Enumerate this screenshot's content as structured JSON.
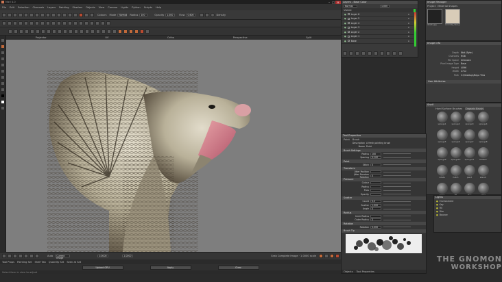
{
  "window": {
    "title": "Mari 4.0"
  },
  "menu": [
    "File",
    "Edit",
    "Selection",
    "Channels",
    "Layers",
    "Painting",
    "Shaders",
    "Objects",
    "View",
    "Camera",
    "Lights",
    "Python",
    "Scripts",
    "Help"
  ],
  "toolbar": {
    "colours_label": "Colours",
    "radius_label": "Radius",
    "radius_value": "100",
    "opacity_label": "Opacity",
    "opacity_value": "1.000",
    "flow_label": "Flow",
    "flow_value": "0.600",
    "density_label": "Density",
    "mode_label": "Mode",
    "mode_value": "Normal"
  },
  "viewport_tabs": [
    "Projector",
    "UV",
    "Ortho",
    "Perspective",
    "Split"
  ],
  "layers": {
    "title": "Layers - Base Color",
    "blend": "Normal",
    "opacity": "1.000",
    "header": "Visible",
    "items": [
      "Layer 6",
      "Layer 5",
      "Layer 4",
      "Layer 3",
      "Layer 2",
      "Layer 1",
      "Base"
    ]
  },
  "image_manager": {
    "title": "Image Manager",
    "tabs": [
      "Project",
      "Material Shapes"
    ],
    "thumbs": [
      "albedo.jpg",
      "concrete_clean_a_Diffuse_4k.jpg"
    ]
  },
  "image_info": {
    "title": "Image Info",
    "rows": [
      {
        "k": "Depth",
        "v": "8bit (Byte)"
      },
      {
        "k": "Channels",
        "v": "RGB"
      },
      {
        "k": "File Space",
        "v": "Unknown"
      },
      {
        "k": "Pixel Image Type",
        "v": "Base"
      },
      {
        "k": "Height",
        "v": "4096"
      },
      {
        "k": "Width",
        "v": "2712"
      },
      {
        "k": "Path",
        "v": "C:\\Desktop\\Maya Tiles"
      }
    ],
    "user_attributes": "User Attributes"
  },
  "shelf": {
    "title": "Shelf",
    "tabs": [
      "Hard Surface Brushes",
      "Organic Brush"
    ],
    "brushes": [
      "sponge1",
      "sponge2",
      "sponge3",
      "sponge4",
      "sponge5",
      "sponge6",
      "sponge7",
      "sponge8",
      "sponge9",
      "sponge10",
      "sponge11",
      "textbox",
      "rotate",
      "hatch",
      "paint",
      "stencil",
      "erase",
      "fill",
      "blur",
      "color",
      "smear",
      "clone",
      "mask",
      "soft"
    ]
  },
  "lights": {
    "title": "Lights",
    "items": [
      "Environment",
      "Key",
      "Fill",
      "Rim",
      "Bounce"
    ]
  },
  "tool_properties": {
    "title": "Tool Properties",
    "tabs": [
      "Paint",
      "Brush"
    ],
    "brush_description_label": "Description",
    "brush_description": "A fresh painting brush",
    "name_label": "Name",
    "name_value": "Paint",
    "sections": [
      {
        "name": "Brush Settings",
        "props": [
          {
            "k": "Radius",
            "v": "100"
          },
          {
            "k": "Spacing",
            "v": "0.100"
          }
        ]
      },
      {
        "name": "Paint",
        "props": [
          {
            "k": "Stitch",
            "v": "0"
          }
        ]
      },
      {
        "name": "Transform",
        "props": [
          {
            "k": "Jitter Position",
            "v": ""
          },
          {
            "k": "Jitter Random Rotation",
            "v": "0"
          }
        ]
      },
      {
        "name": "Pressure",
        "props": [
          {
            "k": "Colour",
            "v": ""
          },
          {
            "k": "Radius",
            "v": ""
          },
          {
            "k": "Flow",
            "v": ""
          },
          {
            "k": "Opacity",
            "v": ""
          }
        ]
      },
      {
        "name": "Scatter",
        "props": [
          {
            "k": "Count",
            "v": "0.0"
          },
          {
            "k": "Scatter",
            "v": "1.000"
          },
          {
            "k": "Angle",
            "v": "0"
          }
        ]
      },
      {
        "name": "Radius",
        "props": [
          {
            "k": "Inner Radius",
            "v": ""
          },
          {
            "k": "Outer Radius",
            "v": "0"
          }
        ]
      },
      {
        "name": "Rotation",
        "props": [
          {
            "k": "Rotation",
            "v": "0.000"
          }
        ]
      }
    ],
    "brush_tip_label": "Brush Tip",
    "bottom_tabs": [
      "Objects",
      "Tool Properties"
    ]
  },
  "bottom": {
    "toolbar_items": [
      "Auto",
      "Current Image",
      "0.0000",
      "2.0000"
    ],
    "status_tabs": [
      "Tool Props",
      "Painting Set",
      "Shelf Tab",
      "Quantity Set",
      "Seen at Set"
    ],
    "selection_info": "Grab Complete Image · 1.0000 scale",
    "buttons": [
      "Upload GPU",
      "Apply",
      "Clear"
    ],
    "hint": "Select item in view to adjust"
  },
  "watermark": {
    "line1": "THE GNOMON",
    "line2": "WORKSHOP"
  },
  "colors": {
    "accent_orange": "#c0693a",
    "layer_blue": "#5a7ea8",
    "bg": "#2b2b2b"
  }
}
